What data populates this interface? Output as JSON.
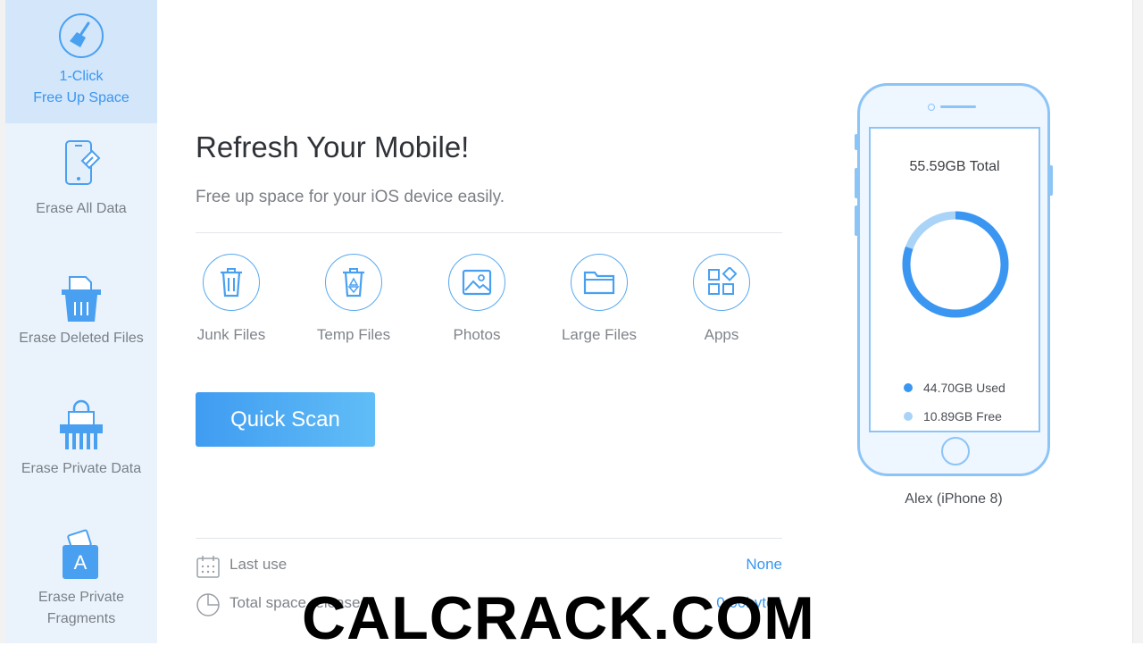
{
  "sidebar": {
    "items": [
      {
        "label": "1-Click\nFree Up Space",
        "icon": "broom-icon",
        "active": true
      },
      {
        "label": "Erase All Data",
        "icon": "phone-erase-icon"
      },
      {
        "label": "Erase Deleted Files",
        "icon": "trash-folder-icon"
      },
      {
        "label": "Erase Private Data",
        "icon": "shredder-lock-icon"
      },
      {
        "label": "Erase Private\nFragments",
        "icon": "app-fragment-icon"
      }
    ]
  },
  "main": {
    "title": "Refresh Your Mobile!",
    "subtitle": "Free up space for your iOS device easily.",
    "categories": [
      {
        "label": "Junk Files",
        "icon": "trash-icon"
      },
      {
        "label": "Temp Files",
        "icon": "recycle-bin-icon"
      },
      {
        "label": "Photos",
        "icon": "image-icon"
      },
      {
        "label": "Large Files",
        "icon": "folder-icon"
      },
      {
        "label": "Apps",
        "icon": "apps-grid-icon"
      }
    ],
    "scan_button": "Quick Scan",
    "info": {
      "last_use_label": "Last use",
      "last_use_value": "None",
      "total_released_label": "Total space released",
      "total_released_value": "0.00bytes"
    }
  },
  "device": {
    "total": "55.59GB Total",
    "used_label": "44.70GB Used",
    "free_label": "10.89GB Free",
    "used_gb": 44.7,
    "free_gb": 10.89,
    "name": "Alex (iPhone 8)"
  },
  "colors": {
    "accent": "#3a96f0",
    "used": "#3a96f0",
    "free": "#a9d3f7",
    "sidebar_bg": "#eaf3fc",
    "sidebar_active_bg": "#d3e6fa"
  },
  "watermark": "CALCRACK.COM"
}
